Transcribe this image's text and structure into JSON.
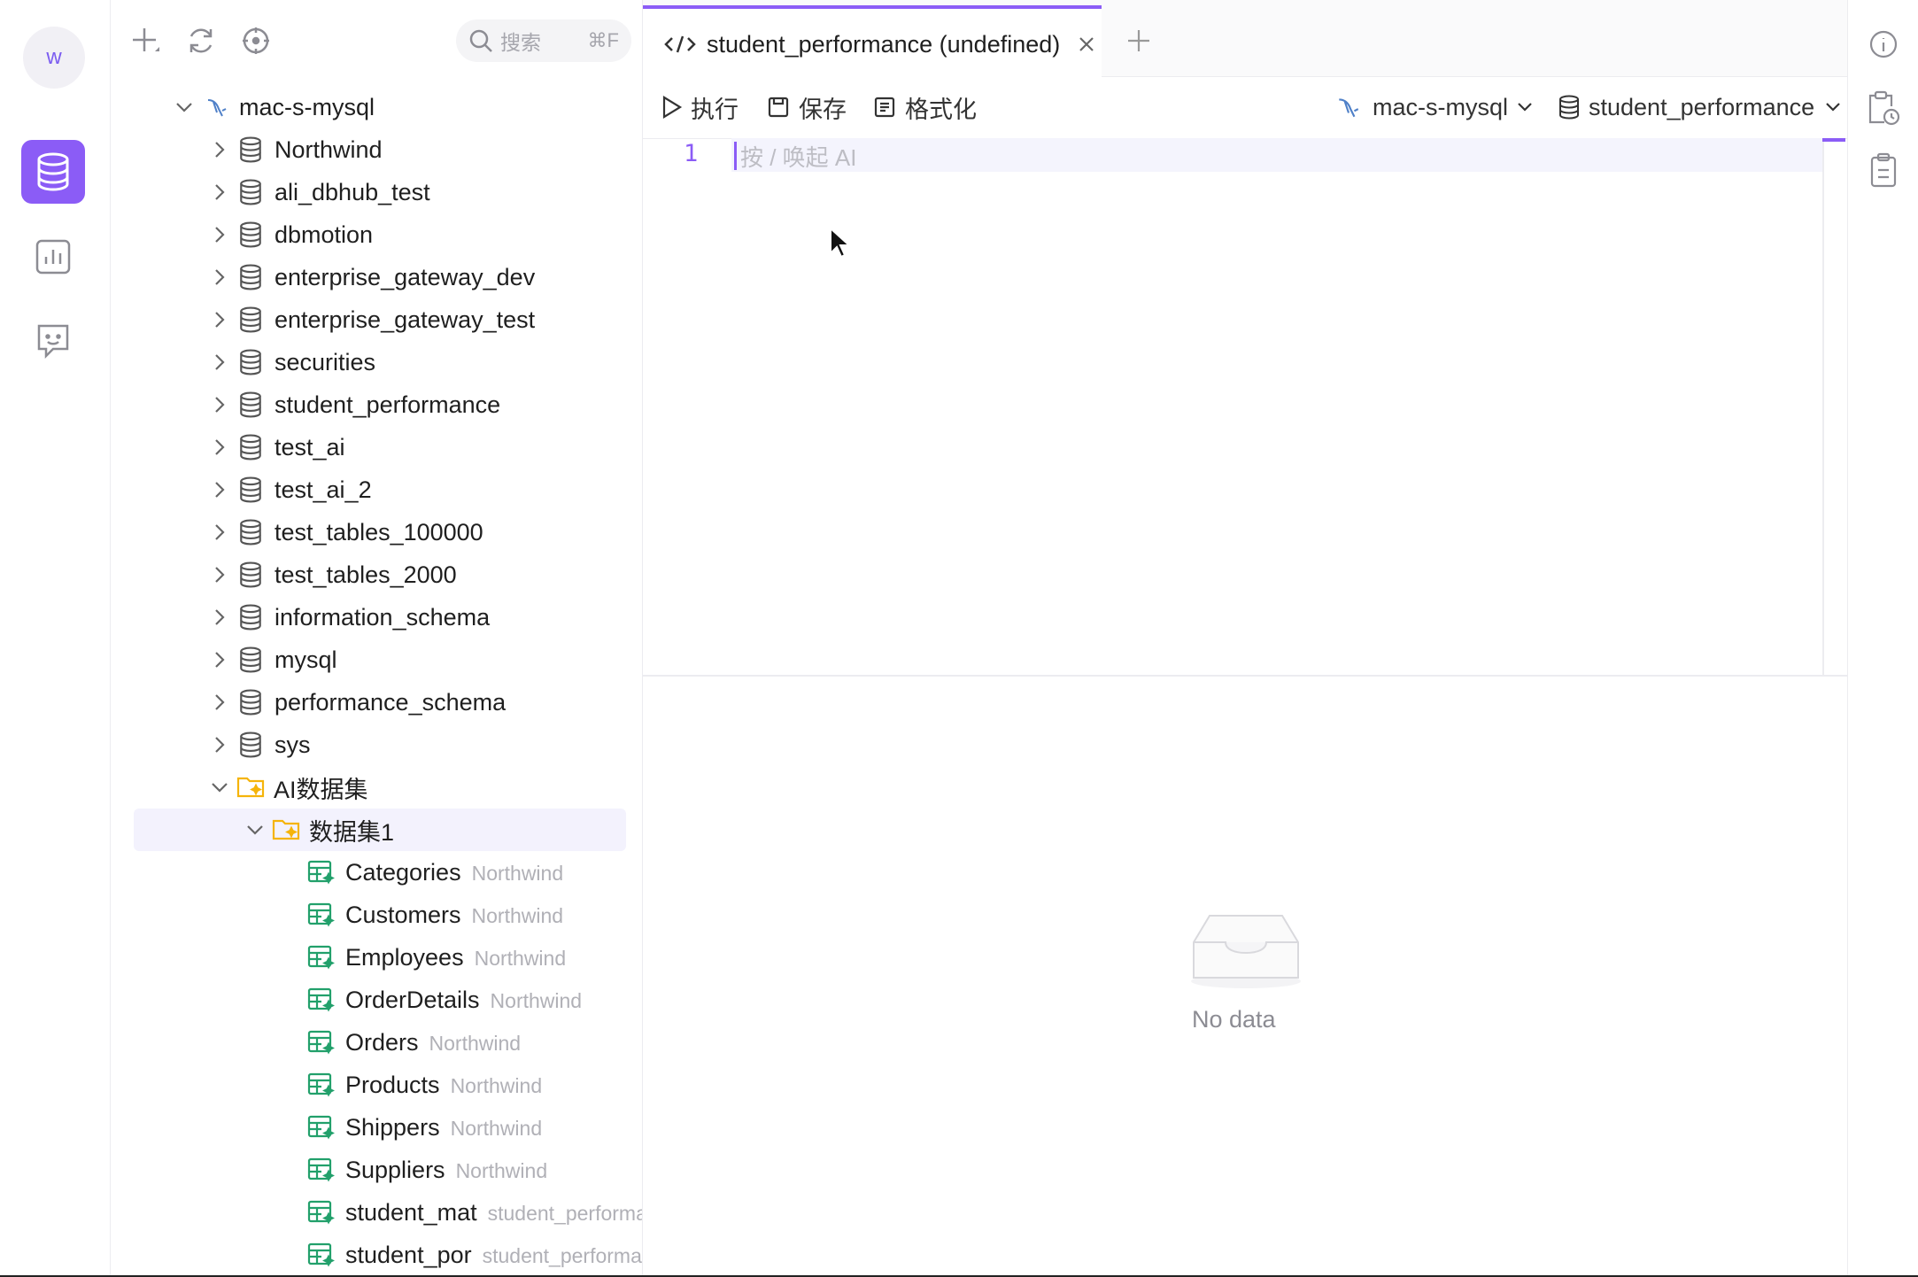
{
  "activity": {
    "avatar_letter": "w",
    "items": [
      "database-icon",
      "chart-icon",
      "chat-bot-icon"
    ]
  },
  "tree": {
    "search_placeholder": "搜索",
    "search_shortcut": "⌘F",
    "connection": "mac-s-mysql",
    "databases": [
      "Northwind",
      "ali_dbhub_test",
      "dbmotion",
      "enterprise_gateway_dev",
      "enterprise_gateway_test",
      "securities",
      "student_performance",
      "test_ai",
      "test_ai_2",
      "test_tables_100000",
      "test_tables_2000",
      "information_schema",
      "mysql",
      "performance_schema",
      "sys"
    ],
    "ai_folder": "AI数据集",
    "dataset_folder": "数据集1",
    "tables": [
      {
        "name": "Categories",
        "source": "Northwind"
      },
      {
        "name": "Customers",
        "source": "Northwind"
      },
      {
        "name": "Employees",
        "source": "Northwind"
      },
      {
        "name": "OrderDetails",
        "source": "Northwind"
      },
      {
        "name": "Orders",
        "source": "Northwind"
      },
      {
        "name": "Products",
        "source": "Northwind"
      },
      {
        "name": "Shippers",
        "source": "Northwind"
      },
      {
        "name": "Suppliers",
        "source": "Northwind"
      },
      {
        "name": "student_mat",
        "source": "student_performa"
      },
      {
        "name": "student_por",
        "source": "student_performa"
      }
    ]
  },
  "editor": {
    "tab_title": "student_performance (undefined)",
    "toolbar": {
      "run": "执行",
      "save": "保存",
      "format": "格式化",
      "connection_select": "mac-s-mysql",
      "database_select": "student_performance"
    },
    "line_number": "1",
    "placeholder": "按 / 唤起 AI",
    "result_empty": "No data"
  },
  "colors": {
    "accent": "#8b5cf6",
    "table_icon": "#22a06b",
    "folder_icon": "#f5b40a"
  }
}
